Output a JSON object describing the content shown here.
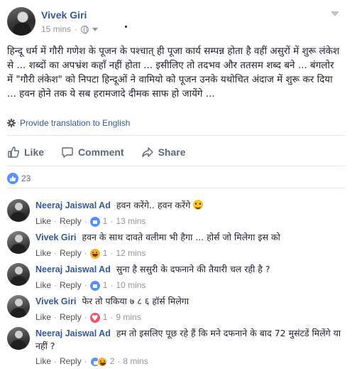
{
  "post": {
    "author": "Vivek Giri",
    "time": "15 mins",
    "text": "हिन्दू धर्म में गौरी गणेश के पूजन के पश्चात् ही पूजा कार्य सम्पन्न होता है वहीं असुरों में शुरू लंकेश से ... शब्दों का अपभ्रंश कहाँ नहीं होता ... इसीलिए तो तदभव और ततसम शब्द बने ... बंगलोर में \"गौरी लंकेश\" को निपटा हिन्दूओं ने वामियो को पूजन उनके यथोचित अंदाज में शुरू कर दिया ... हवन होने तक ये सब हरामजादे दीमक साफ हो जायेंगे ...",
    "translate_label": "Provide translation to English"
  },
  "actions": {
    "like": "Like",
    "comment": "Comment",
    "share": "Share"
  },
  "reactions": {
    "count": "23"
  },
  "comments": [
    {
      "name": "Neeraj Jaiswal Ad",
      "text": "हवन करेंगे.. हवन करेंगे",
      "like": "Like",
      "reply": "Reply",
      "reaction_count": "1",
      "time": "13 mins",
      "reaction_icon": "like-reaction-icon"
    },
    {
      "name": "Vivek Giri",
      "text": "हवन के साथ दावते वलीमा भी हैगा ... होर्स जो मिलेगा इस को",
      "like": "Like",
      "reply": "Reply",
      "reaction_count": "1",
      "time": "12 mins",
      "reaction_icon": "haha-reaction-icon"
    },
    {
      "name": "Neeraj Jaiswal Ad",
      "text": "सुना है ससुरी के दफनाने की तैयारी चल रही है ?",
      "like": "Like",
      "reply": "Reply",
      "reaction_count": "1",
      "time": "10 mins",
      "reaction_icon": "like-reaction-icon"
    },
    {
      "name": "Vivek Giri",
      "text": "फेर तो पकिया ७ ८ ६ हॉर्स मिलेगा",
      "like": "Like",
      "reply": "Reply",
      "reaction_count": "1",
      "time": "9 mins",
      "reaction_icon": "love-reaction-icon"
    },
    {
      "name": "Neeraj Jaiswal Ad",
      "text": "हम तो इसलिए पूछ रहे हैं कि मने दफनाने के बाद 72 मुसंटडें मिलेंगे या नहीं ?",
      "like": "Like",
      "reply": "Reply",
      "reaction_count": "2",
      "time": "8 mins",
      "reaction_icon": "like-haha-reaction-icons"
    }
  ],
  "colors": {
    "link_blue": "#365899",
    "text": "#1d2129",
    "muted": "#90949c",
    "action_gray": "#606770",
    "like_blue": "#5890ff",
    "haha_yellow": "#f7b125",
    "love_red": "#f25268"
  }
}
